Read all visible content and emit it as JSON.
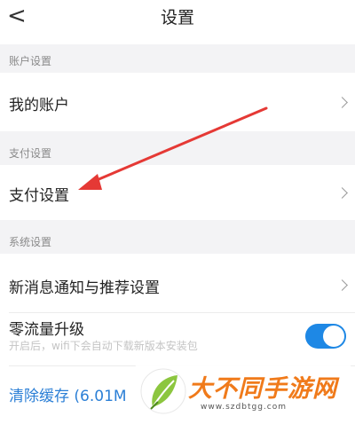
{
  "header": {
    "back_icon": "chevron-left-icon",
    "title": "设置"
  },
  "sections": {
    "account": {
      "label": "账户设置",
      "item": "我的账户"
    },
    "payment": {
      "label": "支付设置",
      "item": "支付设置"
    },
    "system": {
      "label": "系统设置",
      "notify_item": "新消息通知与推荐设置",
      "upgrade_item": "零流量升级",
      "upgrade_desc": "开启后，wifi下会自动下载新版本安装包",
      "upgrade_enabled": true,
      "clear_cache": "清除缓存 (6.01M"
    }
  },
  "watermark": {
    "text": "大不同手游网",
    "url": "www.szdbtgg.com"
  },
  "colors": {
    "accent": "#1e88e5",
    "arrow": "#e53935",
    "section_bg": "#f3f3f5",
    "watermark": "#f07a1a"
  }
}
